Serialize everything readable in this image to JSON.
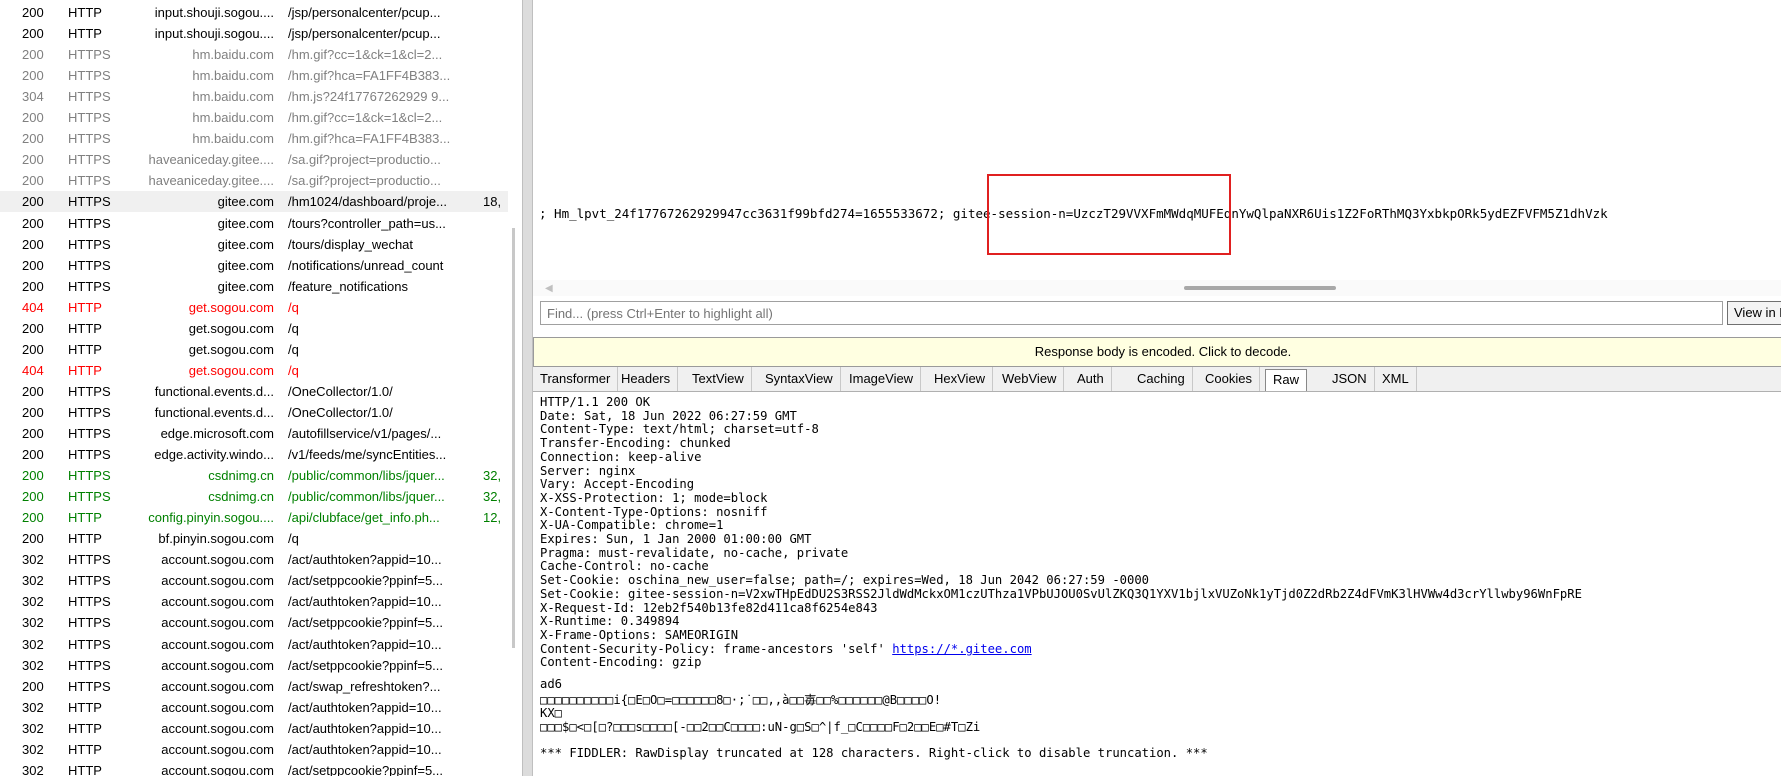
{
  "sessions": [
    {
      "result": "200",
      "protocol": "HTTP",
      "host": "input.shouji.sogou....",
      "url": "/jsp/personalcenter/pcup...",
      "body": "",
      "style": "normal"
    },
    {
      "result": "200",
      "protocol": "HTTP",
      "host": "input.shouji.sogou....",
      "url": "/jsp/personalcenter/pcup...",
      "body": "",
      "style": "normal"
    },
    {
      "result": "200",
      "protocol": "HTTPS",
      "host": "hm.baidu.com",
      "url": "/hm.gif?cc=1&ck=1&cl=2...",
      "body": "",
      "style": "gray"
    },
    {
      "result": "200",
      "protocol": "HTTPS",
      "host": "hm.baidu.com",
      "url": "/hm.gif?hca=FA1FF4B383...",
      "body": "",
      "style": "gray"
    },
    {
      "result": "304",
      "protocol": "HTTPS",
      "host": "hm.baidu.com",
      "url": "/hm.js?24f17767262929 9...",
      "body": "",
      "style": "gray"
    },
    {
      "result": "200",
      "protocol": "HTTPS",
      "host": "hm.baidu.com",
      "url": "/hm.gif?cc=1&ck=1&cl=2...",
      "body": "",
      "style": "gray"
    },
    {
      "result": "200",
      "protocol": "HTTPS",
      "host": "hm.baidu.com",
      "url": "/hm.gif?hca=FA1FF4B383...",
      "body": "",
      "style": "gray"
    },
    {
      "result": "200",
      "protocol": "HTTPS",
      "host": "haveaniceday.gitee....",
      "url": "/sa.gif?project=productio...",
      "body": "",
      "style": "gray"
    },
    {
      "result": "200",
      "protocol": "HTTPS",
      "host": "haveaniceday.gitee....",
      "url": "/sa.gif?project=productio...",
      "body": "",
      "style": "gray"
    },
    {
      "result": "200",
      "protocol": "HTTPS",
      "host": "gitee.com",
      "url": "/hm1024/dashboard/proje...",
      "body": "18,",
      "style": "sel"
    },
    {
      "result": "200",
      "protocol": "HTTPS",
      "host": "gitee.com",
      "url": "/tours?controller_path=us...",
      "body": "",
      "style": "normal"
    },
    {
      "result": "200",
      "protocol": "HTTPS",
      "host": "gitee.com",
      "url": "/tours/display_wechat",
      "body": "",
      "style": "normal"
    },
    {
      "result": "200",
      "protocol": "HTTPS",
      "host": "gitee.com",
      "url": "/notifications/unread_count",
      "body": "",
      "style": "normal"
    },
    {
      "result": "200",
      "protocol": "HTTPS",
      "host": "gitee.com",
      "url": "/feature_notifications",
      "body": "",
      "style": "normal"
    },
    {
      "result": "404",
      "protocol": "HTTP",
      "host": "get.sogou.com",
      "url": "/q",
      "body": "",
      "style": "red"
    },
    {
      "result": "200",
      "protocol": "HTTP",
      "host": "get.sogou.com",
      "url": "/q",
      "body": "",
      "style": "normal"
    },
    {
      "result": "200",
      "protocol": "HTTP",
      "host": "get.sogou.com",
      "url": "/q",
      "body": "",
      "style": "normal"
    },
    {
      "result": "404",
      "protocol": "HTTP",
      "host": "get.sogou.com",
      "url": "/q",
      "body": "",
      "style": "red"
    },
    {
      "result": "200",
      "protocol": "HTTPS",
      "host": "functional.events.d...",
      "url": "/OneCollector/1.0/",
      "body": "",
      "style": "normal"
    },
    {
      "result": "200",
      "protocol": "HTTPS",
      "host": "functional.events.d...",
      "url": "/OneCollector/1.0/",
      "body": "",
      "style": "normal"
    },
    {
      "result": "200",
      "protocol": "HTTPS",
      "host": "edge.microsoft.com",
      "url": "/autofillservice/v1/pages/...",
      "body": "",
      "style": "normal"
    },
    {
      "result": "200",
      "protocol": "HTTPS",
      "host": "edge.activity.windo...",
      "url": "/v1/feeds/me/syncEntities...",
      "body": "",
      "style": "normal"
    },
    {
      "result": "200",
      "protocol": "HTTPS",
      "host": "csdnimg.cn",
      "url": "/public/common/libs/jquer...",
      "body": "32,",
      "style": "green"
    },
    {
      "result": "200",
      "protocol": "HTTPS",
      "host": "csdnimg.cn",
      "url": "/public/common/libs/jquer...",
      "body": "32,",
      "style": "green"
    },
    {
      "result": "200",
      "protocol": "HTTP",
      "host": "config.pinyin.sogou....",
      "url": "/api/clubface/get_info.ph...",
      "body": "12,",
      "style": "green"
    },
    {
      "result": "200",
      "protocol": "HTTP",
      "host": "bf.pinyin.sogou.com",
      "url": "/q",
      "body": "",
      "style": "normal"
    },
    {
      "result": "302",
      "protocol": "HTTPS",
      "host": "account.sogou.com",
      "url": "/act/authtoken?appid=10...",
      "body": "",
      "style": "normal"
    },
    {
      "result": "302",
      "protocol": "HTTPS",
      "host": "account.sogou.com",
      "url": "/act/setppcookie?ppinf=5...",
      "body": "",
      "style": "normal"
    },
    {
      "result": "302",
      "protocol": "HTTPS",
      "host": "account.sogou.com",
      "url": "/act/authtoken?appid=10...",
      "body": "",
      "style": "normal"
    },
    {
      "result": "302",
      "protocol": "HTTPS",
      "host": "account.sogou.com",
      "url": "/act/setppcookie?ppinf=5...",
      "body": "",
      "style": "normal"
    },
    {
      "result": "302",
      "protocol": "HTTPS",
      "host": "account.sogou.com",
      "url": "/act/authtoken?appid=10...",
      "body": "",
      "style": "normal"
    },
    {
      "result": "302",
      "protocol": "HTTPS",
      "host": "account.sogou.com",
      "url": "/act/setppcookie?ppinf=5...",
      "body": "",
      "style": "normal"
    },
    {
      "result": "200",
      "protocol": "HTTPS",
      "host": "account.sogou.com",
      "url": "/act/swap_refreshtoken?...",
      "body": "",
      "style": "normal"
    },
    {
      "result": "302",
      "protocol": "HTTP",
      "host": "account.sogou.com",
      "url": "/act/authtoken?appid=10...",
      "body": "",
      "style": "normal"
    },
    {
      "result": "302",
      "protocol": "HTTP",
      "host": "account.sogou.com",
      "url": "/act/authtoken?appid=10...",
      "body": "",
      "style": "normal"
    },
    {
      "result": "302",
      "protocol": "HTTP",
      "host": "account.sogou.com",
      "url": "/act/authtoken?appid=10...",
      "body": "",
      "style": "normal"
    },
    {
      "result": "302",
      "protocol": "HTTP",
      "host": "account.sogou.com",
      "url": "/act/setppcookie?ppinf=5...",
      "body": "",
      "style": "normal"
    }
  ],
  "request_view": {
    "cookie_line": "; Hm_lpvt_24f17767262929947cc3631f99bfd274=1655533672; gitee-session-n=UzczT29VVXFmMWdqMUFEdnYwQlpaNXR6Uis1Z2FoRThMQ3YxbkpORk5ydEZFVFM5Z1dhVzk"
  },
  "find": {
    "placeholder": "Find... (press Ctrl+Enter to highlight all)",
    "view_button": "View in Notepad"
  },
  "decode_bar": "Response body is encoded. Click to decode.",
  "response_tabs": [
    "Transformer",
    "Headers",
    "TextView",
    "SyntaxView",
    "ImageView",
    "HexView",
    "WebView",
    "Auth",
    "Caching",
    "Cookies",
    "Raw",
    "JSON",
    "XML"
  ],
  "active_tab": "Raw",
  "raw": {
    "headers": [
      "HTTP/1.1 200 OK",
      "Date: Sat, 18 Jun 2022 06:27:59 GMT",
      "Content-Type: text/html; charset=utf-8",
      "Transfer-Encoding: chunked",
      "Connection: keep-alive",
      "Server: nginx",
      "Vary: Accept-Encoding",
      "X-XSS-Protection: 1; mode=block",
      "X-Content-Type-Options: nosniff",
      "X-UA-Compatible: chrome=1",
      "Expires: Sun, 1 Jan 2000 01:00:00 GMT",
      "Pragma: must-revalidate, no-cache, private",
      "Cache-Control: no-cache",
      "Set-Cookie: oschina_new_user=false; path=/; expires=Wed, 18 Jun 2042 06:27:59 -0000",
      "Set-Cookie: gitee-session-n=V2xwTHpEdDU2S3RSS2JldWdMckxOM1czUThza1VPbUJOU0SvUlZKQ3Q1YXV1bjlxVUZoNk1yTjd0Z2dRb2Z4dFVmK3lHVWw4d3crYllwby96WnFpRE",
      "X-Request-Id: 12eb2f540b13fe82d411ca8f6254e843",
      "X-Runtime: 0.349894",
      "X-Frame-Options: SAMEORIGIN"
    ],
    "csp_prefix": "Content-Security-Policy: frame-ancestors 'self' ",
    "csp_link": "https://*.gitee.com",
    "encoding_line": "Content-Encoding: gzip",
    "body_lines": [
      "ad6",
      "□□□□□□□□□□i{□E□O□=□□□□□□8□·;˙□□,,à□□毐□□%□□□□□□@B□□□□O!",
      "KX□",
      "□□□$□<□[□?□□□s□□□□[-□□2□□C□□□□:uN-g□S□^|f_□C□□□□F□2□□E□#T□Zi"
    ],
    "truncation_note": "*** FIDDLER: RawDisplay truncated at 128 characters. Right-click to disable truncation. ***"
  }
}
